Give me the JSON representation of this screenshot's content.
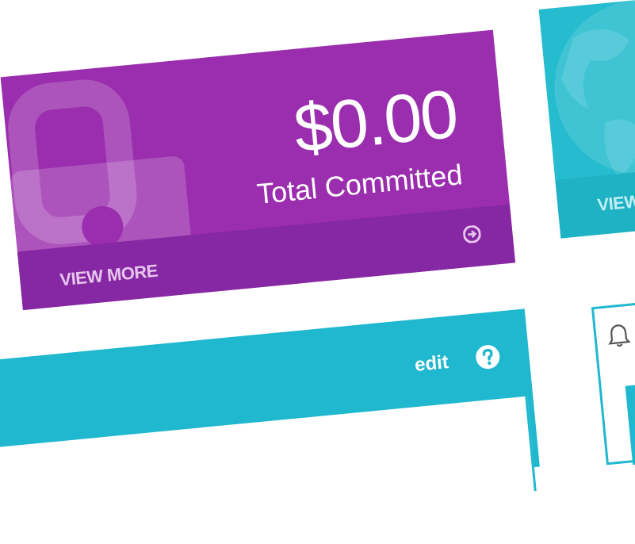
{
  "cards": {
    "committed": {
      "amount": "$0.00",
      "label": "Total Committed",
      "link_label": "VIEW MORE",
      "icon": "lock-icon",
      "link_icon": "arrow-circle-right-icon",
      "color": "#9a2eae"
    },
    "second": {
      "link_label": "VIEW",
      "icon": "globe-icon",
      "color": "#26bccf"
    }
  },
  "panel": {
    "edit_label": "edit",
    "help_icon": "question-circle-icon",
    "color": "#1fb8cf"
  },
  "right_panel": {
    "icon": "bell-icon"
  }
}
